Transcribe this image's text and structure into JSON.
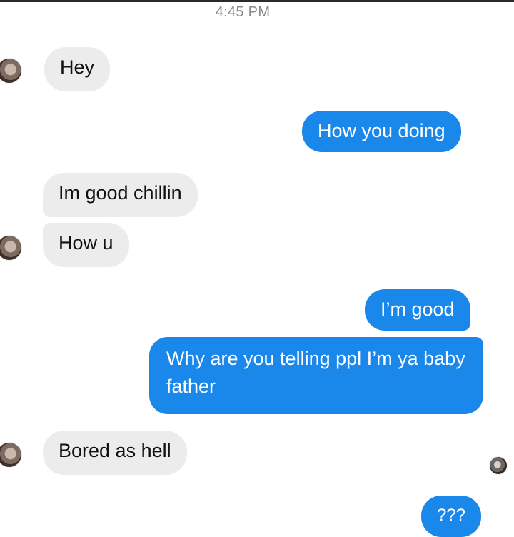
{
  "header": {
    "time": "4:45 PM"
  },
  "messages": [
    {
      "text": "Hey",
      "direction": "incoming"
    },
    {
      "text": "How you doing",
      "direction": "outgoing"
    },
    {
      "text": "Im good chillin",
      "direction": "incoming"
    },
    {
      "text": "How u",
      "direction": "incoming"
    },
    {
      "text": "I’m good",
      "direction": "outgoing"
    },
    {
      "text": "Why are you telling ppl I’m ya baby father",
      "direction": "outgoing"
    },
    {
      "text": "Bored as hell",
      "direction": "incoming"
    },
    {
      "text": "???",
      "direction": "outgoing"
    }
  ],
  "colors": {
    "outgoing_bubble": "#1a88ea",
    "incoming_bubble": "#ececec",
    "timestamp": "#8a8a8a"
  }
}
